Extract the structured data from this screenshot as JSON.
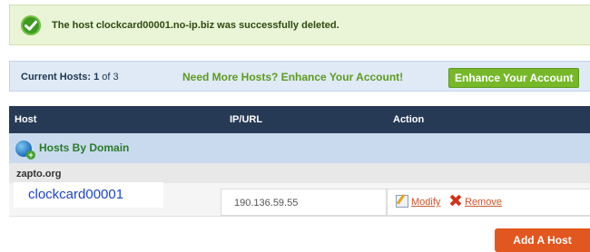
{
  "success": {
    "message": "The host clockcard00001.no-ip.biz was successfully deleted."
  },
  "host_summary": {
    "label": "Current Hosts:",
    "current": "1",
    "of_text": "of 3",
    "promo": "Need More Hosts? Enhance Your Account!",
    "enhance_button": "Enhance Your Account"
  },
  "table": {
    "columns": [
      "Host",
      "IP/URL",
      "Action"
    ],
    "group_title": "Hosts By Domain",
    "domain": "zapto.org",
    "rows": [
      {
        "host": "clockcard00001",
        "ip": "190.136.59.55",
        "modify": "Modify",
        "remove": "Remove"
      }
    ]
  },
  "add_host_button": "Add A Host",
  "colors": {
    "success_bg": "#eaf4d6",
    "header_bg": "#273a55",
    "group_bg": "#c9daee",
    "accent_green": "#76b82a",
    "action_link": "#d2542c",
    "add_button": "#e2571f"
  }
}
